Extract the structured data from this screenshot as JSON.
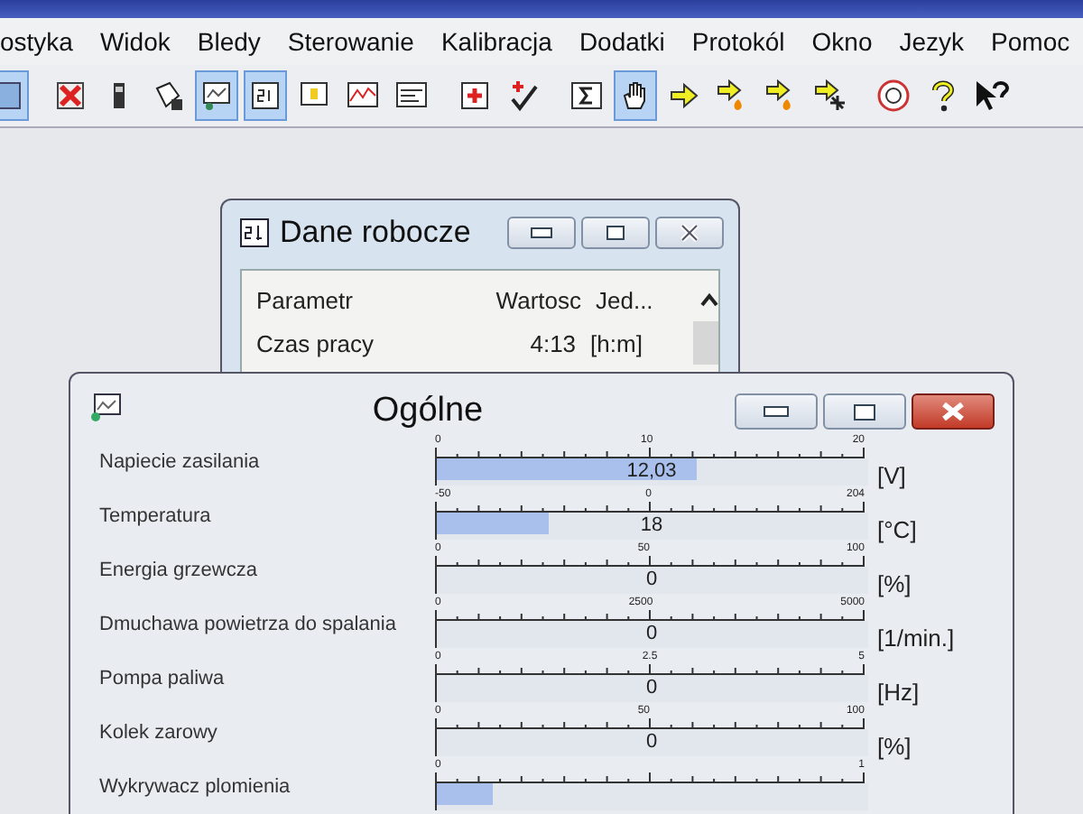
{
  "menu": [
    {
      "label": "ostyka"
    },
    {
      "label": "Widok"
    },
    {
      "label": "Bledy"
    },
    {
      "label": "Sterowanie"
    },
    {
      "label": "Kalibracja"
    },
    {
      "label": "Dodatki"
    },
    {
      "label": "Protokól"
    },
    {
      "label": "Okno"
    },
    {
      "label": "Jezyk"
    },
    {
      "label": "Pomoc"
    }
  ],
  "toolbar": [
    {
      "kind": "tools",
      "selected": true
    },
    {
      "kind": "cross",
      "selected": false
    },
    {
      "kind": "phone",
      "selected": false
    },
    {
      "kind": "bucket",
      "selected": false
    },
    {
      "kind": "monitor",
      "selected": true
    },
    {
      "kind": "numbers",
      "selected": true
    },
    {
      "kind": "note",
      "selected": false
    },
    {
      "kind": "graph",
      "selected": false
    },
    {
      "kind": "list",
      "selected": false
    },
    {
      "kind": "plus",
      "selected": false
    },
    {
      "kind": "check",
      "selected": false
    },
    {
      "kind": "sigma",
      "selected": false
    },
    {
      "kind": "hand",
      "selected": true
    },
    {
      "kind": "arrow",
      "selected": false
    },
    {
      "kind": "arrowflame",
      "selected": false
    },
    {
      "kind": "arrowflame",
      "selected": false
    },
    {
      "kind": "arrowfan",
      "selected": false
    },
    {
      "kind": "co2",
      "selected": false
    },
    {
      "kind": "help",
      "selected": false
    },
    {
      "kind": "pointerhelp",
      "selected": false
    }
  ],
  "work_window": {
    "title": "Dane robocze",
    "active": false,
    "columns": [
      "Parametr",
      "Wartosc",
      "Jed..."
    ],
    "rows": [
      {
        "cells": [
          "Czas pracy",
          "4:13",
          "[h:m]"
        ]
      }
    ]
  },
  "general_window": {
    "title": "Ogólne",
    "active": true,
    "gauges": [
      {
        "label": "Napiecie zasilania",
        "scale": [
          "0",
          "10",
          "20"
        ],
        "level": 0.6,
        "value": "12,03",
        "unit": "[V]"
      },
      {
        "label": "Temperatura",
        "scale": [
          "-50",
          "0",
          "204"
        ],
        "level": 0.26,
        "value": "18",
        "unit": "[°C]"
      },
      {
        "label": "Energia grzewcza",
        "scale": [
          "0",
          "50",
          "100"
        ],
        "level": 0,
        "value": "0",
        "unit": "[%]"
      },
      {
        "label": "Dmuchawa powietrza do spalania",
        "scale": [
          "0",
          "2500",
          "5000"
        ],
        "level": 0,
        "value": "0",
        "unit": "[1/min.]"
      },
      {
        "label": "Pompa paliwa",
        "scale": [
          "0",
          "2.5",
          "5"
        ],
        "level": 0,
        "value": "0",
        "unit": "[Hz]"
      },
      {
        "label": "Kolek zarowy",
        "scale": [
          "0",
          "50",
          "100"
        ],
        "level": 0,
        "value": "0",
        "unit": "[%]"
      },
      {
        "label": "Wykrywacz plomienia",
        "scale": [
          "0",
          "1"
        ],
        "level": 0.13
      }
    ]
  }
}
